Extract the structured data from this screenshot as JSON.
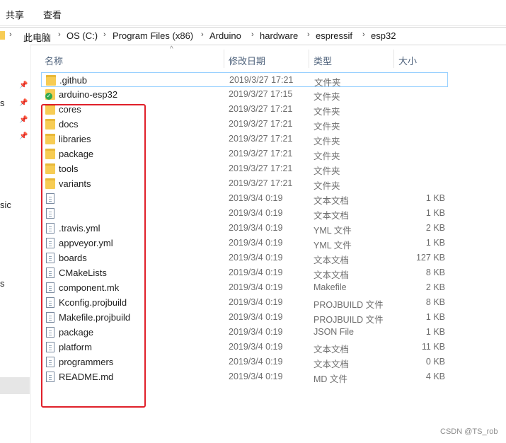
{
  "ribbon": {
    "tabs": [
      "共享",
      "查看"
    ]
  },
  "address": {
    "segments": [
      "此电脑",
      "OS (C:)",
      "Program Files (x86)",
      "Arduino",
      "hardware",
      "espressif",
      "esp32"
    ]
  },
  "sidebar": {
    "stubs": [
      "s",
      "sic",
      "s"
    ]
  },
  "columns": {
    "name": "名称",
    "date": "修改日期",
    "type": "类型",
    "size": "大小"
  },
  "files": [
    {
      "name": ".github",
      "date": "2019/3/27 17:21",
      "type": "文件夹",
      "size": "",
      "icon": "folder-icon"
    },
    {
      "name": "arduino-esp32",
      "date": "2019/3/27 17:15",
      "type": "文件夹",
      "size": "",
      "icon": "git-folder-icon"
    },
    {
      "name": "cores",
      "date": "2019/3/27 17:21",
      "type": "文件夹",
      "size": "",
      "icon": "folder-icon"
    },
    {
      "name": "docs",
      "date": "2019/3/27 17:21",
      "type": "文件夹",
      "size": "",
      "icon": "folder-icon"
    },
    {
      "name": "libraries",
      "date": "2019/3/27 17:21",
      "type": "文件夹",
      "size": "",
      "icon": "folder-icon"
    },
    {
      "name": "package",
      "date": "2019/3/27 17:21",
      "type": "文件夹",
      "size": "",
      "icon": "folder-icon"
    },
    {
      "name": "tools",
      "date": "2019/3/27 17:21",
      "type": "文件夹",
      "size": "",
      "icon": "folder-icon"
    },
    {
      "name": "variants",
      "date": "2019/3/27 17:21",
      "type": "文件夹",
      "size": "",
      "icon": "folder-icon"
    },
    {
      "name": "",
      "date": "2019/3/4 0:19",
      "type": "文本文档",
      "size": "1 KB",
      "icon": "text-file-icon"
    },
    {
      "name": "",
      "date": "2019/3/4 0:19",
      "type": "文本文档",
      "size": "1 KB",
      "icon": "text-file-icon"
    },
    {
      "name": ".travis.yml",
      "date": "2019/3/4 0:19",
      "type": "YML 文件",
      "size": "2 KB",
      "icon": "file-icon"
    },
    {
      "name": "appveyor.yml",
      "date": "2019/3/4 0:19",
      "type": "YML 文件",
      "size": "1 KB",
      "icon": "file-icon"
    },
    {
      "name": "boards",
      "date": "2019/3/4 0:19",
      "type": "文本文档",
      "size": "127 KB",
      "icon": "text-file-icon"
    },
    {
      "name": "CMakeLists",
      "date": "2019/3/4 0:19",
      "type": "文本文档",
      "size": "8 KB",
      "icon": "text-file-icon"
    },
    {
      "name": "component.mk",
      "date": "2019/3/4 0:19",
      "type": "Makefile",
      "size": "2 KB",
      "icon": "makefile-icon"
    },
    {
      "name": "Kconfig.projbuild",
      "date": "2019/3/4 0:19",
      "type": "PROJBUILD 文件",
      "size": "8 KB",
      "icon": "file-icon"
    },
    {
      "name": "Makefile.projbuild",
      "date": "2019/3/4 0:19",
      "type": "PROJBUILD 文件",
      "size": "1 KB",
      "icon": "file-icon"
    },
    {
      "name": "package",
      "date": "2019/3/4 0:19",
      "type": "JSON File",
      "size": "1 KB",
      "icon": "json-file-icon"
    },
    {
      "name": "platform",
      "date": "2019/3/4 0:19",
      "type": "文本文档",
      "size": "11 KB",
      "icon": "text-file-icon"
    },
    {
      "name": "programmers",
      "date": "2019/3/4 0:19",
      "type": "文本文档",
      "size": "0 KB",
      "icon": "text-file-icon"
    },
    {
      "name": "README.md",
      "date": "2019/3/4 0:19",
      "type": "MD 文件",
      "size": "4 KB",
      "icon": "file-icon"
    }
  ],
  "watermark": "CSDN @TS_rob",
  "colors": {
    "highlight_box": "#e0202a",
    "selection_border": "#99d1ff",
    "folder": "#f7cc54"
  }
}
